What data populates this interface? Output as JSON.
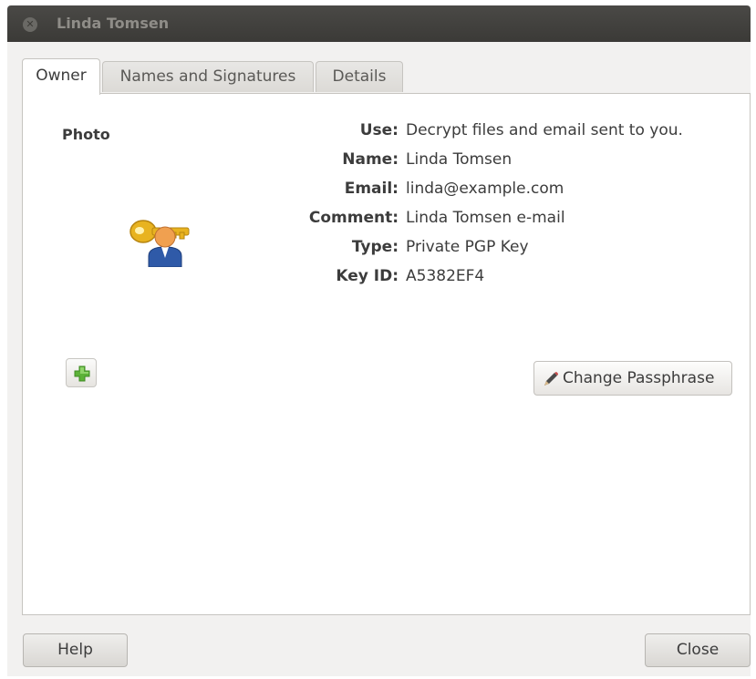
{
  "window": {
    "title": "Linda Tomsen"
  },
  "tabs": [
    {
      "label": "Owner",
      "active": true
    },
    {
      "label": "Names and Signatures",
      "active": false
    },
    {
      "label": "Details",
      "active": false
    }
  ],
  "owner": {
    "photo_label": "Photo",
    "fields": [
      {
        "label": "Use:",
        "value": "Decrypt files and email sent to you."
      },
      {
        "label": "Name:",
        "value": "Linda Tomsen"
      },
      {
        "label": "Email:",
        "value": "linda@example.com"
      },
      {
        "label": "Comment:",
        "value": "Linda Tomsen e-mail"
      },
      {
        "label": "Type:",
        "value": "Private PGP Key"
      },
      {
        "label": "Key ID:",
        "value": "A5382EF4"
      }
    ],
    "change_passphrase_label": "Change Passphrase",
    "add_photo_icon": "plus-icon",
    "key_icon": "key-person-icon"
  },
  "footer": {
    "help_label": "Help",
    "close_label": "Close"
  },
  "colors": {
    "titlebar": "#3c3b37",
    "key_gold": "#e8b320",
    "person_blue": "#2f5aa8",
    "plus_green": "#5cb238"
  }
}
